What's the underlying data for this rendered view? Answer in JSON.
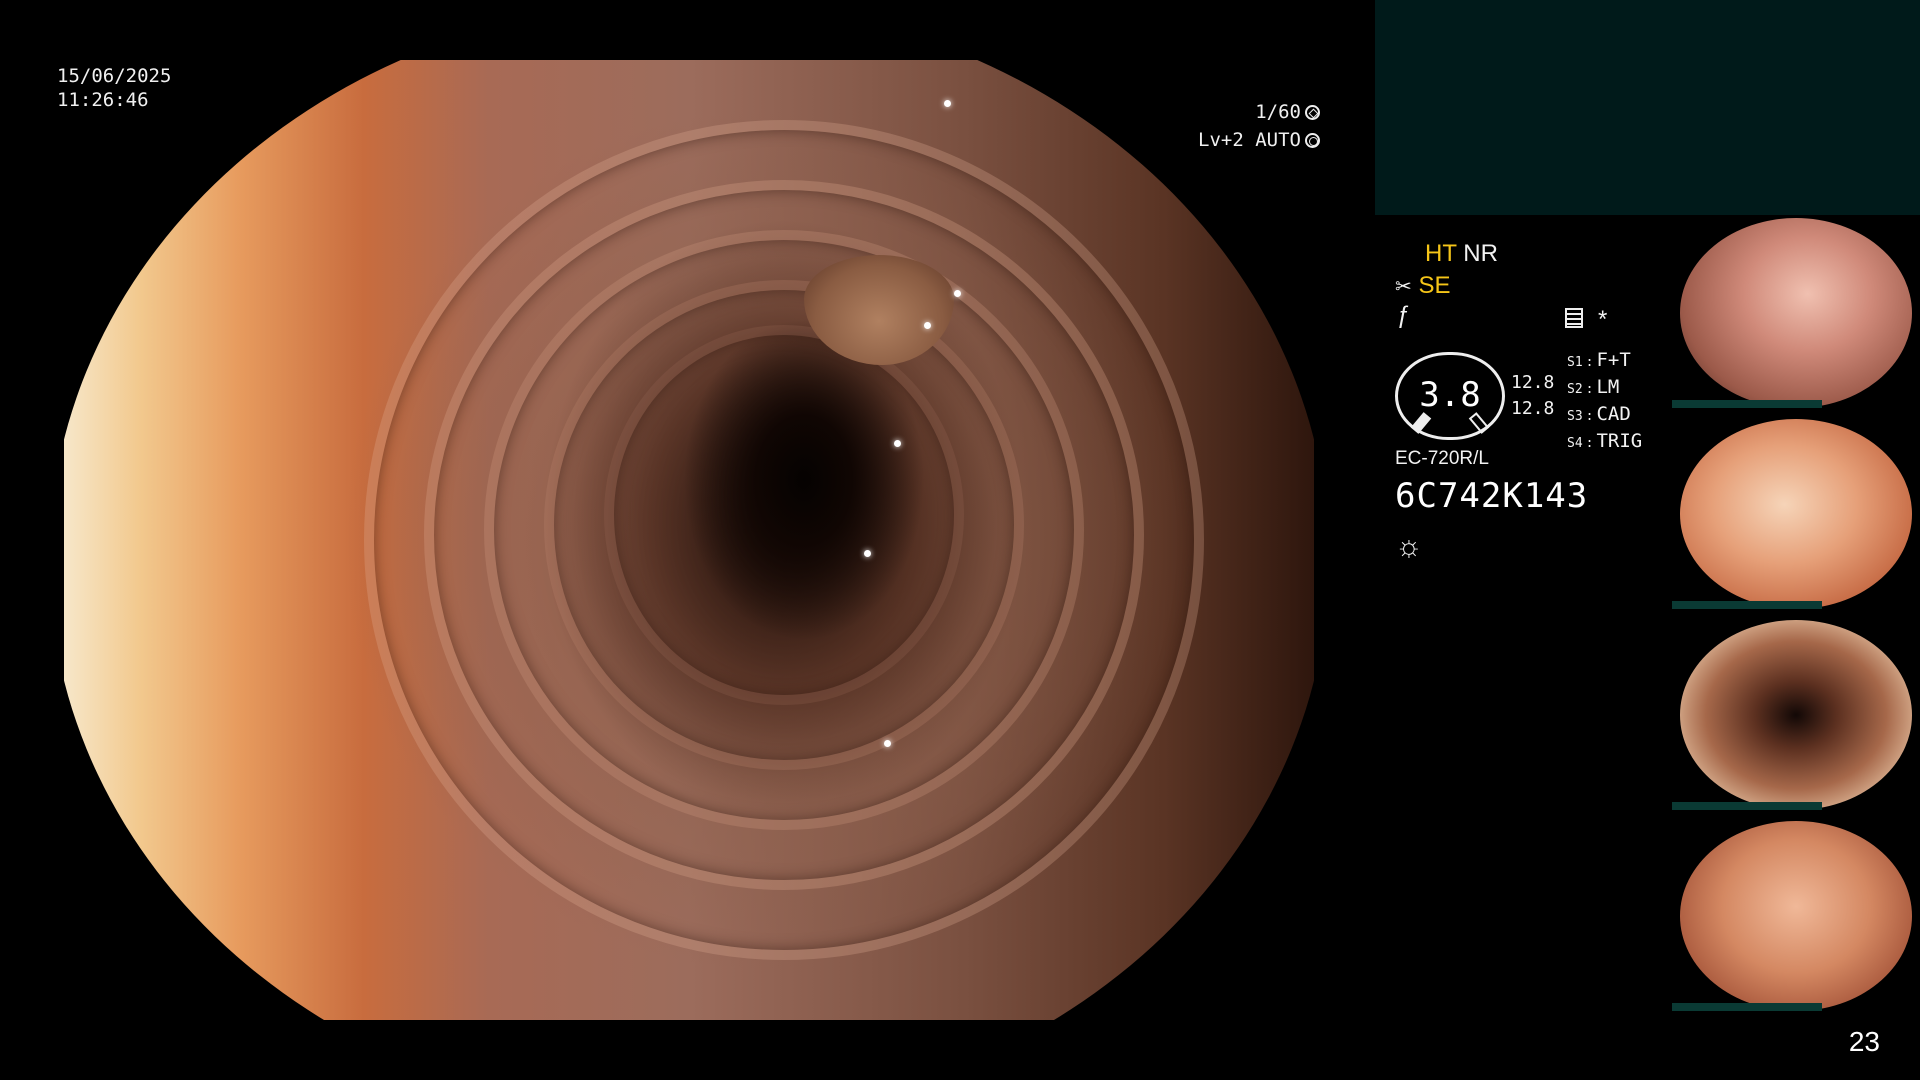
{
  "datetime": {
    "date": "15/06/2025",
    "time": "11:26:46"
  },
  "exposure": {
    "shutter": "1/60",
    "shutter_icon": "shutter-icon",
    "level": "Lv+2 AUTO",
    "iris_icon": "iris-icon"
  },
  "status": {
    "ht": "HT",
    "nr": "NR",
    "se": "SE",
    "se_icon": "scissor-icon",
    "f_icon": "f-icon",
    "memo_icon": "memo-icon",
    "star": "*",
    "gauge_value": "3.8",
    "gauge_side": [
      "12.8",
      "12.8"
    ],
    "s_items": [
      {
        "key": "S1",
        "label": "F+T"
      },
      {
        "key": "S2",
        "label": "LM"
      },
      {
        "key": "S3",
        "label": "CAD"
      },
      {
        "key": "S4",
        "label": "TRIG"
      }
    ],
    "scope_model": "EC-720R/L",
    "scope_serial": "6C742K143",
    "light_icon": "sun-icon"
  },
  "thumbnails": [
    {
      "id": "thumb-1"
    },
    {
      "id": "thumb-2"
    },
    {
      "id": "thumb-3"
    },
    {
      "id": "thumb-4"
    }
  ],
  "page_number": "23",
  "colors": {
    "accent_yellow": "#f5c518",
    "panel_teal": "#001a1a",
    "thumb_bar": "#0a3a34"
  }
}
